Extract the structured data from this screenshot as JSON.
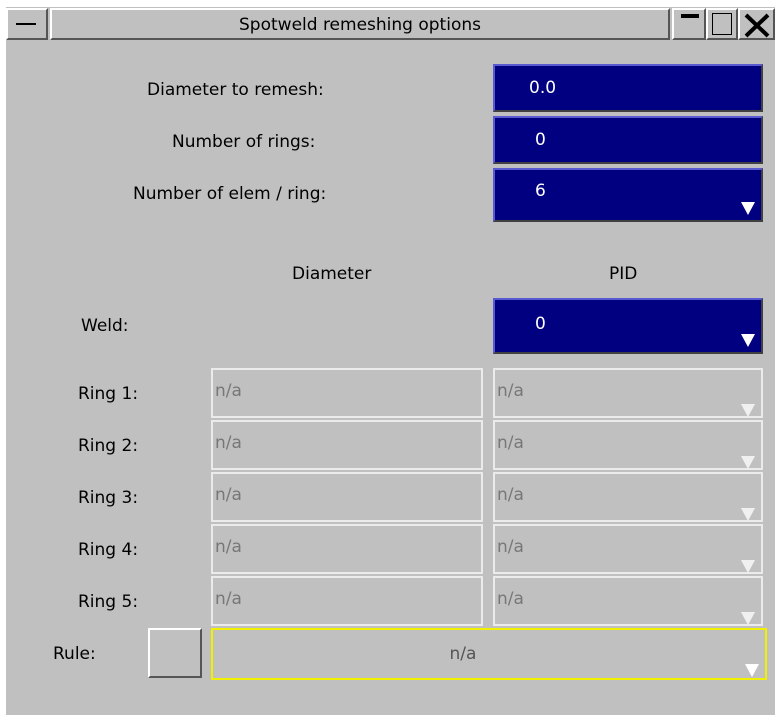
{
  "window": {
    "title": "Spotweld remeshing options",
    "controls": {
      "minimize": "minimize-icon",
      "maximize": "maximize-icon",
      "close": "close-icon",
      "menu": "window-menu-icon"
    }
  },
  "settings": {
    "diameter_label": "Diameter to remesh:",
    "diameter_value": "0.0",
    "rings_label": "Number of rings:",
    "rings_value": "0",
    "elems_label": "Number of elem / ring:",
    "elems_value": "6"
  },
  "table": {
    "col_diameter": "Diameter",
    "col_pid": "PID",
    "weld_label": "Weld:",
    "weld_pid": "0",
    "rings": [
      {
        "label": "Ring 1:",
        "diameter": "n/a",
        "pid": "n/a"
      },
      {
        "label": "Ring 2:",
        "diameter": "n/a",
        "pid": "n/a"
      },
      {
        "label": "Ring 3:",
        "diameter": "n/a",
        "pid": "n/a"
      },
      {
        "label": "Ring 4:",
        "diameter": "n/a",
        "pid": "n/a"
      },
      {
        "label": "Ring 5:",
        "diameter": "n/a",
        "pid": "n/a"
      }
    ]
  },
  "rule": {
    "label": "Rule:",
    "value": "n/a"
  },
  "colors": {
    "panel": "#c0c0c0",
    "field_active": "#000080",
    "rule_border": "#f0f000"
  }
}
